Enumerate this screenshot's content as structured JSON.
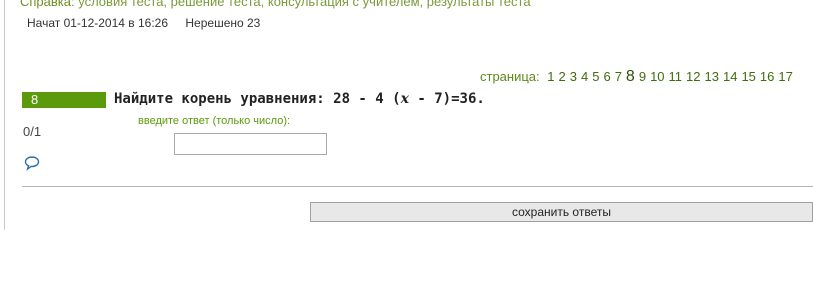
{
  "help": {
    "label": "Справка:",
    "links_text": " условия теста, решение теста, консультация с учителем, результаты теста"
  },
  "status": {
    "started": "Начат 01-12-2014 в 16:26",
    "unsolved": "Нерешено 23"
  },
  "pagination": {
    "label": "страница:",
    "pages": [
      "1",
      "2",
      "3",
      "4",
      "5",
      "6",
      "7",
      "8",
      "9",
      "10",
      "11",
      "12",
      "13",
      "14",
      "15",
      "16",
      "17"
    ],
    "current": "8"
  },
  "question": {
    "number": "8",
    "text_before": "Найдите корень уравнения: 28 - 4 (",
    "variable": "x",
    "text_after": " - 7)=36.",
    "hint": "введите ответ (только число):",
    "score": "0/1",
    "answer_value": ""
  },
  "actions": {
    "save_label": "сохранить ответы"
  },
  "icons": {
    "comment": "speech-bubble-icon"
  },
  "colors": {
    "accent_green": "#5b9a0a",
    "link_green": "#3f6c0c"
  }
}
